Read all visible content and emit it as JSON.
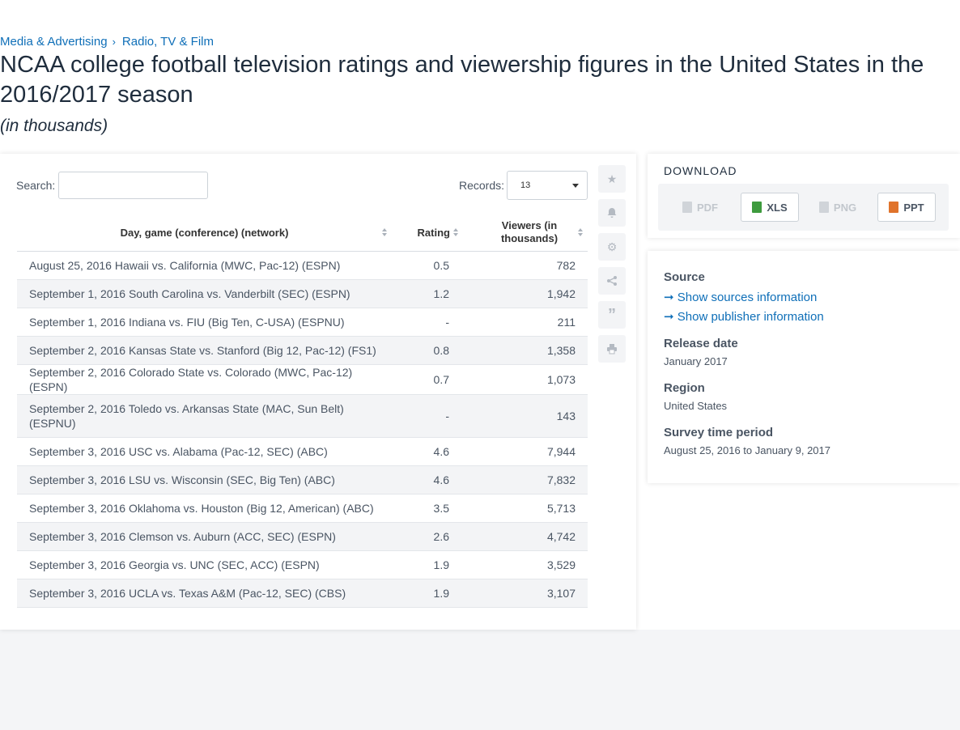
{
  "breadcrumb": {
    "items": [
      "Media & Advertising",
      "Radio, TV & Film"
    ],
    "separator": "›"
  },
  "title": "NCAA college football television ratings and viewership figures in the United States in the 2016/2017 season",
  "unit": "(in thousands)",
  "table_controls": {
    "search_label": "Search:",
    "records_label": "Records:",
    "records_value": "13"
  },
  "table": {
    "columns": [
      "Day, game (conference) (network)",
      "Rating",
      "Viewers (in thousands)"
    ],
    "rows": [
      [
        "August 25, 2016 Hawaii vs. California (MWC, Pac-12) (ESPN)",
        "0.5",
        "782"
      ],
      [
        "September 1, 2016 South Carolina vs. Vanderbilt (SEC) (ESPN)",
        "1.2",
        "1,942"
      ],
      [
        "September 1, 2016 Indiana vs. FIU (Big Ten, C-USA) (ESPNU)",
        "-",
        "211"
      ],
      [
        "September 2, 2016 Kansas State vs. Stanford (Big 12, Pac-12) (FS1)",
        "0.8",
        "1,358"
      ],
      [
        "September 2, 2016 Colorado State vs. Colorado (MWC, Pac-12) (ESPN)",
        "0.7",
        "1,073"
      ],
      [
        "September 2, 2016 Toledo vs. Arkansas State (MAC, Sun Belt) (ESPNU)",
        "-",
        "143"
      ],
      [
        "September 3, 2016 USC vs. Alabama (Pac-12, SEC) (ABC)",
        "4.6",
        "7,944"
      ],
      [
        "September 3, 2016 LSU vs. Wisconsin (SEC, Big Ten) (ABC)",
        "4.6",
        "7,832"
      ],
      [
        "September 3, 2016 Oklahoma vs. Houston (Big 12, American) (ABC)",
        "3.5",
        "5,713"
      ],
      [
        "September 3, 2016 Clemson vs. Auburn (ACC, SEC) (ESPN)",
        "2.6",
        "4,742"
      ],
      [
        "September 3, 2016 Georgia vs. UNC (SEC, ACC) (ESPN)",
        "1.9",
        "3,529"
      ],
      [
        "September 3, 2016 UCLA vs. Texas A&M (Pac-12, SEC) (CBS)",
        "1.9",
        "3,107"
      ]
    ]
  },
  "side_tools": [
    "star-icon",
    "bell-icon",
    "gear-icon",
    "share-icon",
    "quote-icon",
    "print-icon"
  ],
  "download": {
    "title": "DOWNLOAD",
    "buttons": [
      {
        "label": "PDF",
        "enabled": false
      },
      {
        "label": "XLS",
        "enabled": true
      },
      {
        "label": "PNG",
        "enabled": false
      },
      {
        "label": "PPT",
        "enabled": true
      }
    ]
  },
  "info": {
    "source_heading": "Source",
    "show_sources": "Show sources information",
    "show_publisher": "Show publisher information",
    "release_heading": "Release date",
    "release_value": "January 2017",
    "region_heading": "Region",
    "region_value": "United States",
    "survey_heading": "Survey time period",
    "survey_value": "August 25, 2016 to January 9, 2017"
  },
  "colors": {
    "link": "#0f6fb8",
    "title": "#1f2d3d",
    "xls": "#3e9b3e",
    "ppt": "#e0732b"
  }
}
